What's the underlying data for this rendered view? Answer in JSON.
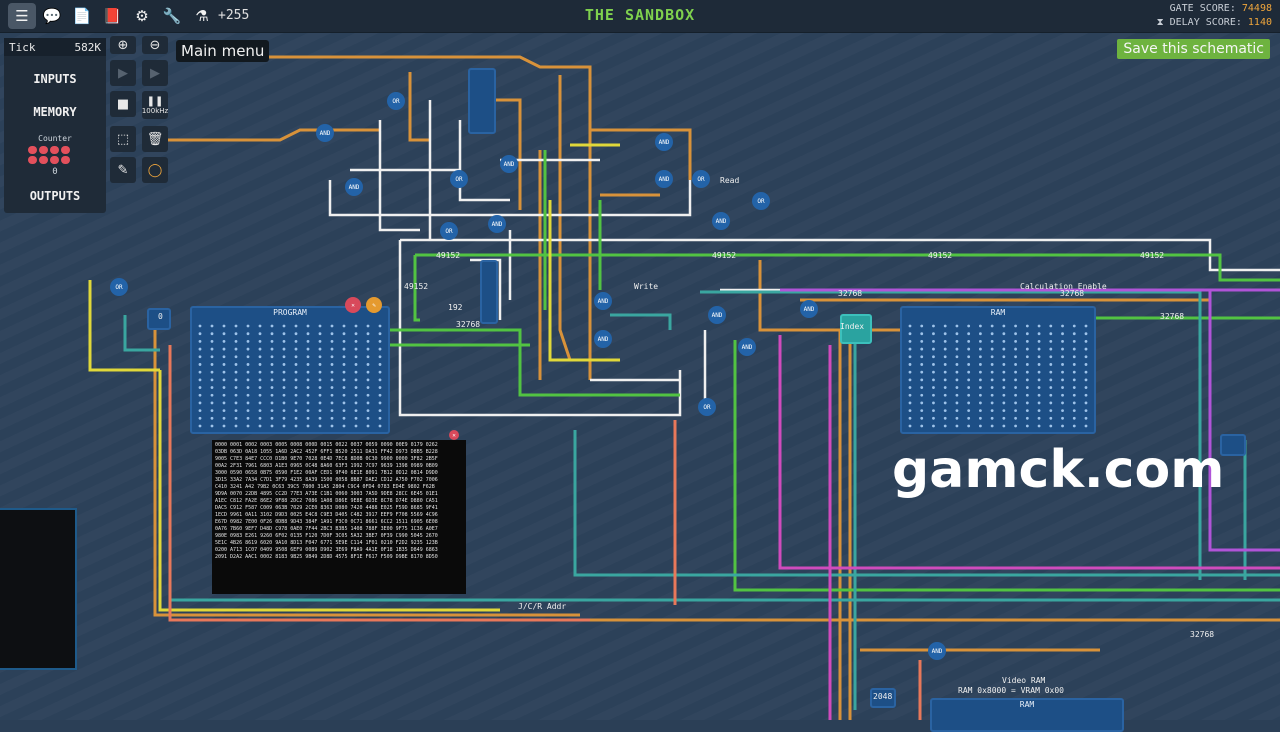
{
  "toolbar": {
    "buttons": [
      {
        "name": "menu-icon",
        "glyph": "☰"
      },
      {
        "name": "chat-icon",
        "glyph": "💬"
      },
      {
        "name": "document-icon",
        "glyph": "📄"
      },
      {
        "name": "book-icon",
        "glyph": "📕"
      },
      {
        "name": "gear-icon",
        "glyph": "⚙"
      },
      {
        "name": "wrench-icon",
        "glyph": "🔧"
      },
      {
        "name": "flask-icon",
        "glyph": "⚗"
      }
    ],
    "counter": "+255"
  },
  "title": "THE SANDBOX",
  "scores": {
    "gate_label": "GATE SCORE:",
    "gate_value": "74498",
    "delay_label": "DELAY SCORE:",
    "delay_value": "1140",
    "delay_icon": "hourglass-icon"
  },
  "sim": {
    "tick_label": "Tick",
    "tick_value": "582K",
    "speed": "100kHz",
    "counter_label": "Counter",
    "counter_value": "0"
  },
  "panel_buttons": {
    "inputs": "INPUTS",
    "memory": "MEMORY",
    "outputs": "OUTPUTS"
  },
  "tools": {
    "zoom_in": "⊕",
    "zoom_out": "⊖",
    "step": "▶",
    "run": "▶",
    "stop": "■",
    "pause": "❚❚",
    "select": "⬚",
    "delete": "🗑",
    "pencil": "✎",
    "color": "◯"
  },
  "tooltip": "Main menu",
  "save_button": "Save this schematic",
  "watermark": "gamck.com",
  "components": {
    "program_title": "PROGRAM",
    "ram_title": "RAM",
    "ram2_title": "RAM",
    "calc_enable": "Calculation Enable",
    "addr_label": "J/C/R Addr",
    "video_ram": "Video RAM",
    "vram_note": "RAM 0x8000 = VRAM 0x00",
    "write_label": "Write",
    "read_label": "Read",
    "index_label": "Index"
  },
  "wire_values": [
    "49152",
    "49152",
    "49152",
    "49152",
    "49152",
    "32768",
    "32768",
    "32768",
    "32768",
    "32768",
    "192",
    "0",
    "2048"
  ],
  "mem_dump": [
    "0000 0001 0002 0003 0005 0008 000D 0015 0022 0037 0059 0090 00E9 0179 0262",
    "03DB 063D 0A18 1055 1A6D 2AC2 452F 6FF1 B520 2511 DA31 FF42 D973 D8B5 B228",
    "9005 C7E3 84E7 CCC0 D1B0 9E70 7028 0E4D 7EC8 8D0B 0C30 9900 0000 3F82 2B5F",
    "00A2 2F31 7961 6803 A1E3 0965 0C48 8A60 63F3 1992 7C97 9639 1398 0989 0B09",
    "3000 0590 0658 0B75 0590 F1E2 00AF CED1 9F40 6E1E 8091 7B12 0D12 0814 D9D0",
    "3D15 33A2 7A34 C7D1 3F79 4235 8A39 1500 0058 8B87 DAE2 CD12 A750 F702 7006",
    "C410 3241 A42 79B2 0C63 39C5 7800 31A5 2804 C9C4 0FD4 0783 ED4E 9802 F62B",
    "9D9A 0070 22DB 4895 CC2D 77E3 A73E C1B1 0060 3003 7A5D 9DE8 28CC 6E45 01E1",
    "A1EC C812 FA2E 86E2 9F88 2DC2 7086 1A08 D86E 9E8E 6D3E 8C78 D74E D880 CA51",
    "DAC5 C912 F587 C009 063B 7029 2CE0 8363 D080 7420 4488 E025 F59D 8685 9F41",
    "1ECD 9961 0A11 3102 D9D3 0025 E4C8 C9E3 D405 C482 3917 EEF9 F708 5569 4C96",
    "E67D 0982 7E00 0F26 0DB8 9D43 384F 1A91 F3C0 0C71 8661 6CC2 1511 6905 6E08",
    "0A76 7B60 9EF7 D48D C978 0AE0 7F44 2BC3 B3B5 1408 788F 3E00 9F75 1C36 A0E7",
    "980E 0983 E261 9260 6F02 0135 F120 7D0F 3C05 5A32 3BE7 0F39 C990 5045 2670",
    "5E1C 4B26 8619 6020 9A10 8D13 F047 6771 5E9E C114 1F01 0210 F2D2 9235 123B",
    "0200 A713 1C07 0409 9508 6EF9 0089 D902 3E69 F8A9 4A1E 0F18 1B35 D849 6863",
    "2091 D2A2 AAC1 0002 8183 9B25 9B49 2D8D 4575 8F1E F617 F509 D9BE 8170 8D50"
  ]
}
